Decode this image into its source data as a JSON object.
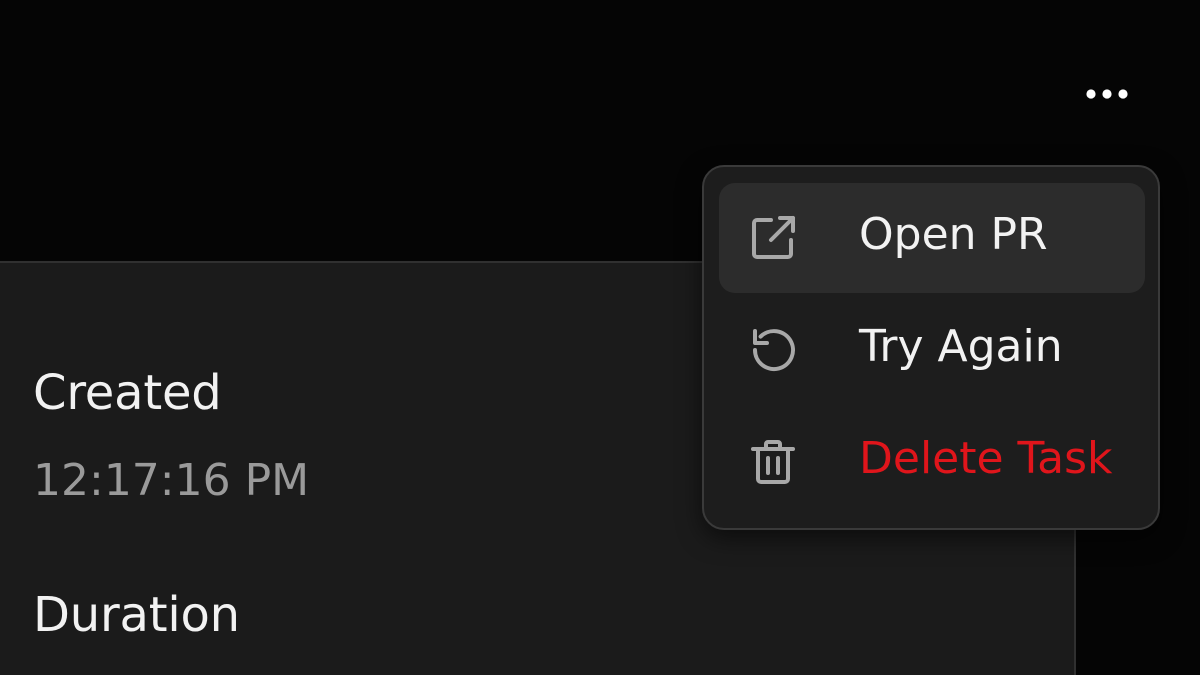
{
  "header": {
    "more_icon": "more-horizontal-icon"
  },
  "details": {
    "created_label": "Created",
    "created_value": "12:17:16 PM",
    "duration_label": "Duration"
  },
  "menu": {
    "items": [
      {
        "label": "Open PR",
        "icon": "external-link-icon",
        "highlighted": true
      },
      {
        "label": "Try Again",
        "icon": "retry-icon",
        "highlighted": false
      },
      {
        "label": "Delete Task",
        "icon": "trash-icon",
        "highlighted": false,
        "destructive": true
      }
    ]
  },
  "colors": {
    "background": "#050505",
    "panel": "#1b1b1b",
    "menu": "#1d1d1d",
    "menu_highlight": "#2c2c2c",
    "text_primary": "#f2f2f2",
    "text_secondary": "#9a9a9a",
    "destructive": "#e0151b"
  }
}
